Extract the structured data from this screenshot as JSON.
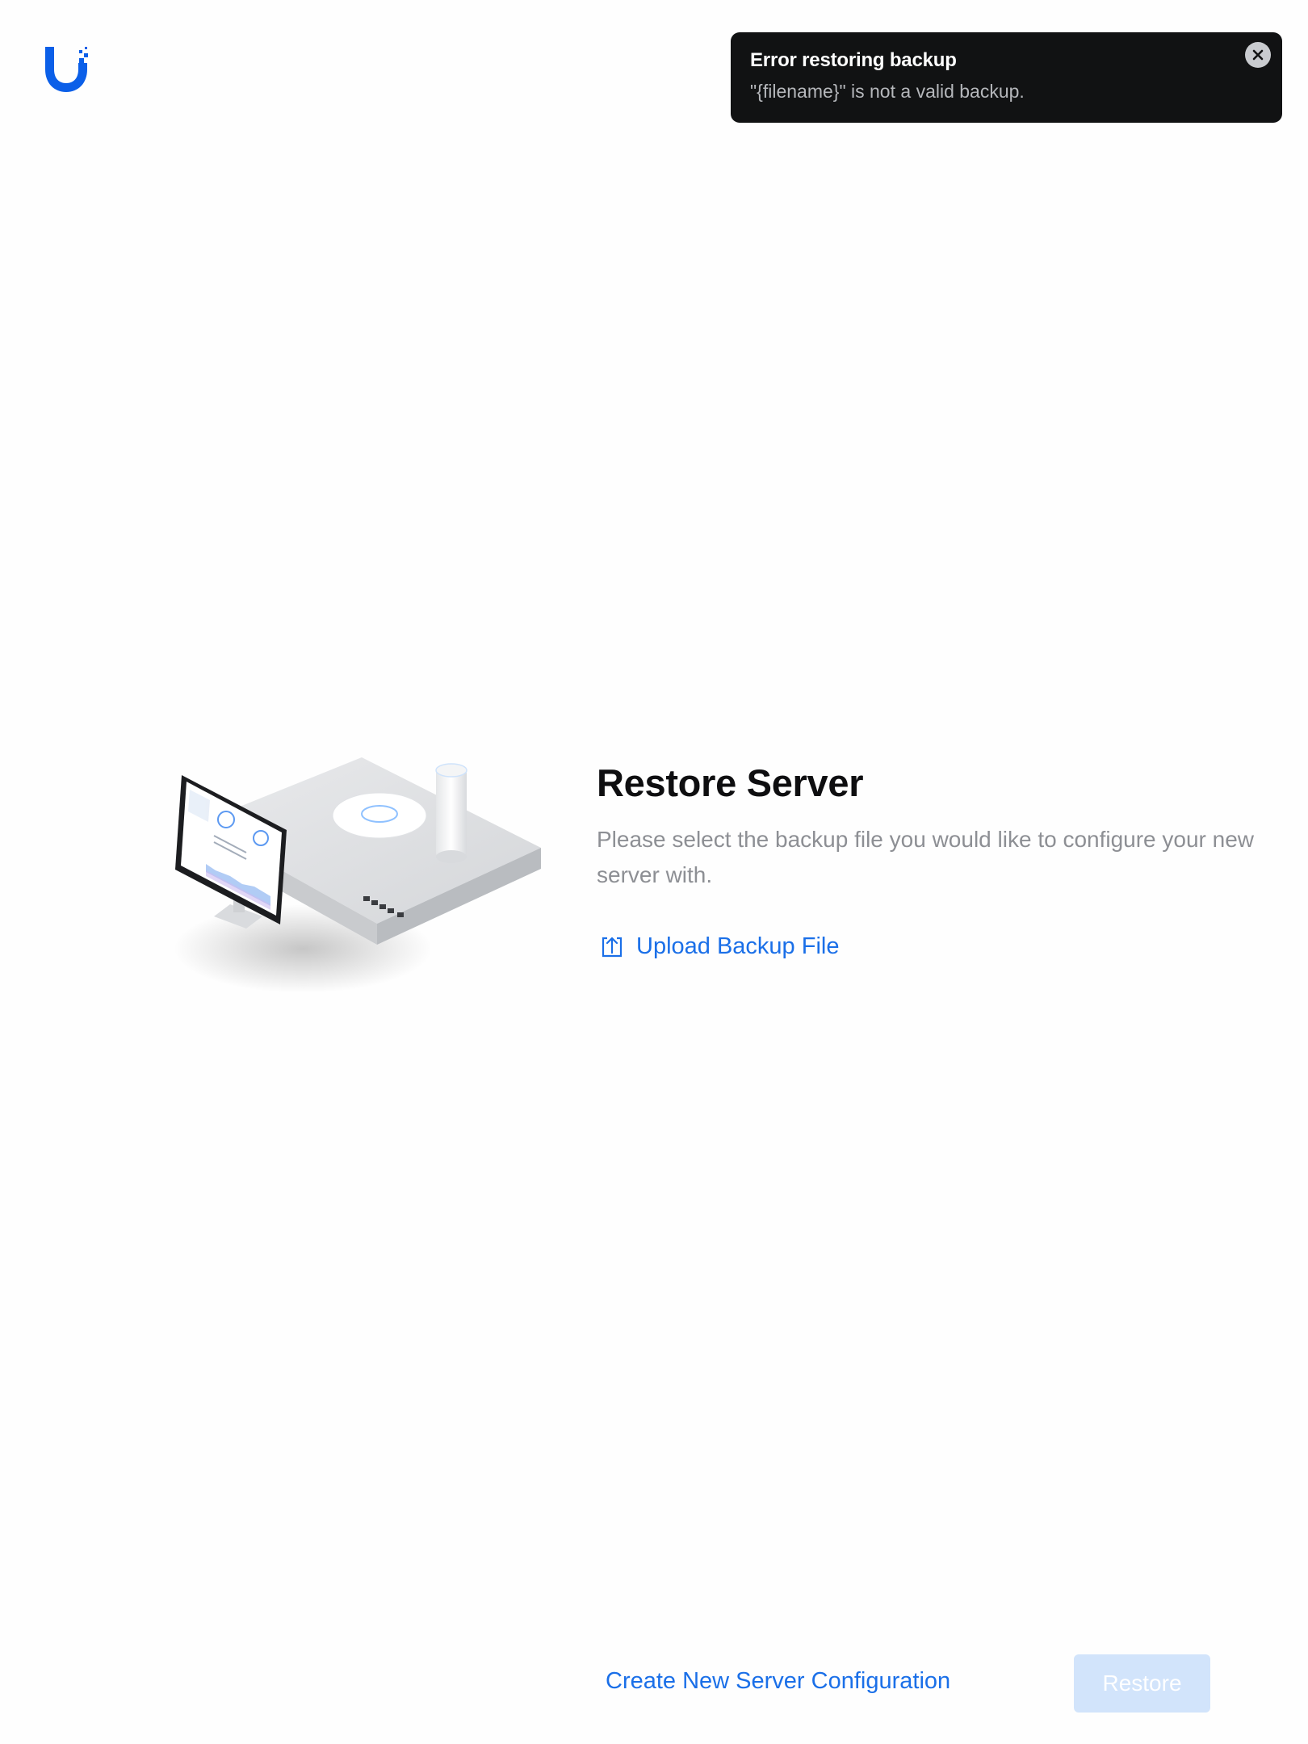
{
  "app": {
    "logo_icon": "ubiquiti-u-logo-icon",
    "accent_color": "#1a6fe8"
  },
  "toast": {
    "title": "Error restoring backup",
    "message": "\"{filename}\" is not a valid backup.",
    "close_icon": "close-icon",
    "background_color": "#111213"
  },
  "main": {
    "illustration": "server-devices-illustration",
    "title": "Restore Server",
    "description": "Please select the backup file you would like to configure your new server with.",
    "upload_icon": "upload-icon",
    "upload_label": "Upload Backup File"
  },
  "footer": {
    "create_label": "Create New Server Configuration",
    "restore_label": "Restore",
    "restore_disabled": true
  }
}
